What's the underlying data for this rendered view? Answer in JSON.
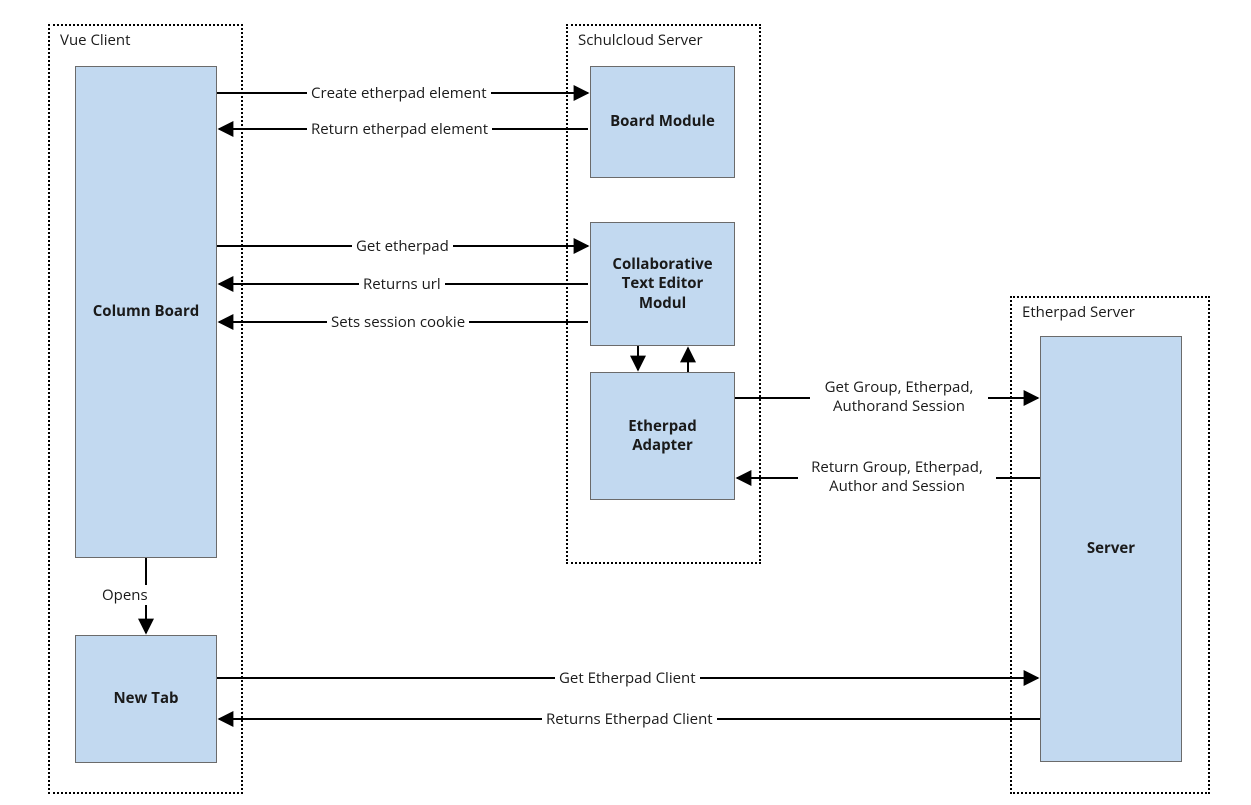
{
  "groups": {
    "vue": {
      "label": "Vue Client"
    },
    "scs": {
      "label": "Schulcloud Server"
    },
    "eps": {
      "label": "Etherpad Server"
    }
  },
  "nodes": {
    "column_board": {
      "label": "Column Board"
    },
    "new_tab": {
      "label": "New Tab"
    },
    "board_module": {
      "label": "Board Module"
    },
    "cte": {
      "label": "Collaborative Text Editor Modul"
    },
    "adapter": {
      "label": "Etherpad Adapter"
    },
    "server": {
      "label": "Server"
    }
  },
  "edges": {
    "e1": "Create etherpad element",
    "e2": "Return etherpad element",
    "e3": "Get etherpad",
    "e4": "Returns url",
    "e5": "Sets session cookie",
    "e6": "Get Group, Etherpad, Authorand Session",
    "e7": "Return Group, Etherpad, Author and Session",
    "e8": "Opens",
    "e9": "Get Etherpad Client",
    "e10": "Returns Etherpad Client"
  }
}
